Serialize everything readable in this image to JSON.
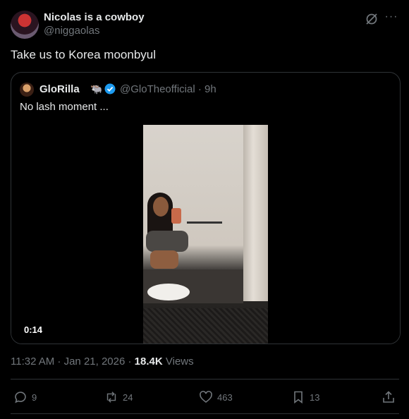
{
  "post": {
    "author_name": "Nicolas is a cowboy",
    "author_handle": "@niggaolas",
    "text": "Take us to Korea moonbyul",
    "timestamp": "11:32 AM · Jan 21, 2026 ·",
    "views_count": "18.4K",
    "views_label": "Views"
  },
  "quote": {
    "author_name": "GloRilla",
    "author_emoji": "🐃",
    "author_handle": "@GloTheofficial · 9h",
    "text": "No lash moment ...",
    "video_duration": "0:14"
  },
  "actions": {
    "replies": "9",
    "reposts": "24",
    "likes": "463",
    "bookmarks": "13"
  },
  "icons": {
    "grok": "grok-icon",
    "more": "more-icon",
    "verified": "verified-badge-icon",
    "reply": "reply-icon",
    "repost": "repost-icon",
    "like": "heart-icon",
    "bookmark": "bookmark-icon",
    "share": "share-icon"
  },
  "colors": {
    "background": "#000000",
    "text": "#e7e9ea",
    "muted": "#71767b",
    "border": "#2f3336",
    "verified": "#1d9bf0"
  }
}
